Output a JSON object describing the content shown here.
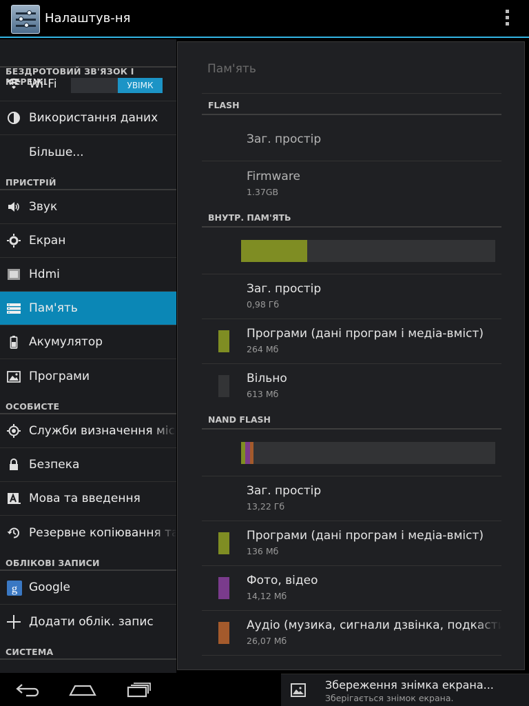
{
  "app": {
    "title": "Налаштув-ня"
  },
  "left": {
    "sections": [
      {
        "header": "БЕЗДРОТОВИЙ ЗВ'ЯЗОК І МЕРЕЖІ",
        "items": [
          {
            "label": "Wi-Fi",
            "icon": "wifi-icon",
            "toggle": "УВІМК"
          },
          {
            "label": "Використання даних",
            "icon": "data-usage-icon"
          },
          {
            "label": "Більше...",
            "icon": ""
          }
        ]
      },
      {
        "header": "ПРИСТРІЙ",
        "items": [
          {
            "label": "Звук",
            "icon": "volume-icon"
          },
          {
            "label": "Екран",
            "icon": "brightness-icon"
          },
          {
            "label": "Hdmi",
            "icon": "hdmi-icon"
          },
          {
            "label": "Пам'ять",
            "icon": "storage-icon",
            "selected": true
          },
          {
            "label": "Акумулятор",
            "icon": "battery-icon"
          },
          {
            "label": "Програми",
            "icon": "apps-icon"
          }
        ]
      },
      {
        "header": "ОСОБИСТЕ",
        "items": [
          {
            "label": "Служби визначення місцезнаходження",
            "icon": "location-icon"
          },
          {
            "label": "Безпека",
            "icon": "lock-icon"
          },
          {
            "label": "Мова та введення",
            "icon": "language-icon"
          },
          {
            "label": "Резервне копіювання та скидання",
            "icon": "backup-icon"
          }
        ]
      },
      {
        "header": "ОБЛІКОВІ ЗАПИСИ",
        "items": [
          {
            "label": "Google",
            "icon": "google-icon"
          },
          {
            "label": "Додати облік. запис",
            "icon": "add-icon"
          }
        ]
      },
      {
        "header": "СИСТЕМА",
        "items": []
      }
    ]
  },
  "right": {
    "title": "Пам'ять",
    "flash": {
      "header": "FLASH",
      "total_label": "Заг. простір",
      "firmware_label": "Firmware",
      "firmware_value": "1.37GB"
    },
    "internal": {
      "header": "ВНУТР. ПАМ'ЯТЬ",
      "used_fraction": 0.26,
      "total_label": "Заг. простір",
      "total_value": "0,98 Гб",
      "apps_label": "Програми (дані програм і медіа-вміст)",
      "apps_value": "264 Мб",
      "free_label": "Вільно",
      "free_value": "613 Мб"
    },
    "nand": {
      "header": "NAND FLASH",
      "total_label": "Заг. простір",
      "total_value": "13,22 Гб",
      "apps_label": "Програми (дані програм і медіа-вміст)",
      "apps_value": "136 Мб",
      "photo_label": "Фото, відео",
      "photo_value": "14,12 Мб",
      "audio_label": "Аудіо (музика, сигнали дзвінка, подкасти)",
      "audio_value": "26,07 Мб"
    },
    "colors": {
      "apps": "#7f8d23",
      "free": "#333436",
      "photo": "#7a3b8c",
      "audio": "#a45a2c"
    }
  },
  "notification": {
    "title": "Збереження знімка екрана...",
    "subtitle": "Зберігається знімок екрана."
  }
}
